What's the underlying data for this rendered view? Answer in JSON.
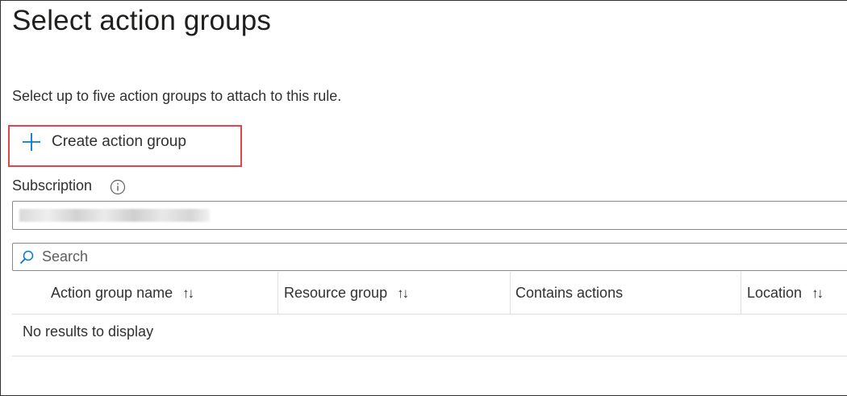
{
  "title": "Select action groups",
  "description": "Select up to five action groups to attach to this rule.",
  "create_button": {
    "label": "Create action group",
    "icon": "plus-icon",
    "accent": "#0078d4",
    "highlight": "#e0474c"
  },
  "subscription": {
    "label": "Subscription",
    "info_icon": "info-icon",
    "value": ""
  },
  "search": {
    "placeholder": "Search",
    "value": "",
    "icon": "search-icon"
  },
  "table": {
    "columns": [
      {
        "label": "Action group name",
        "sortable": true
      },
      {
        "label": "Resource group",
        "sortable": true
      },
      {
        "label": "Contains actions",
        "sortable": false
      },
      {
        "label": "Location",
        "sortable": true
      }
    ],
    "sort_glyph": "↑↓",
    "empty_message": "No results to display"
  }
}
